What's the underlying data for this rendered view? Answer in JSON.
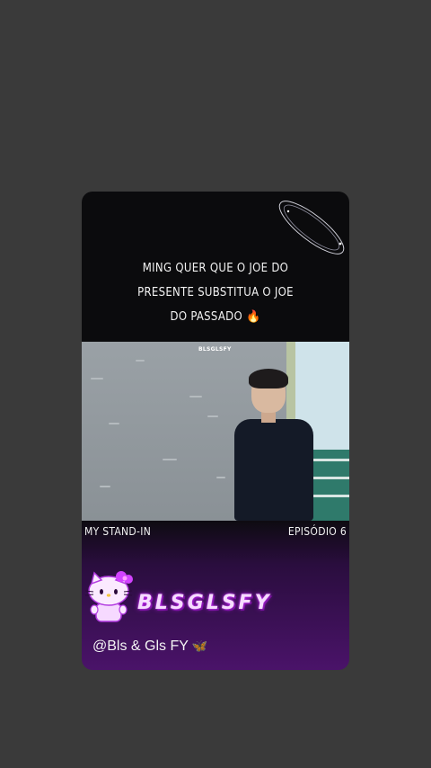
{
  "story": {
    "headline_lines": [
      "MING QUER QUE O JOE DO",
      "PRESENTE SUBSTITUA O JOE",
      "DO PASSADO 🔥"
    ],
    "video_watermark": "BLSGLSFY",
    "show_title": "MY STAND-IN",
    "episode": "EPISÓDIO 6",
    "brand_logo_text": "BLSGLSFY",
    "handle": "@Bls & Gls FY",
    "handle_emoji": "🦋"
  },
  "colors": {
    "background": "#3a3a3a",
    "card_top": "#0b0b0d",
    "card_bottom": "#4a1369",
    "brand_glow": "#d243ff"
  },
  "icons": [
    "orbit-rings-decoration",
    "hello-kitty-logo-icon",
    "butterfly-icon"
  ]
}
